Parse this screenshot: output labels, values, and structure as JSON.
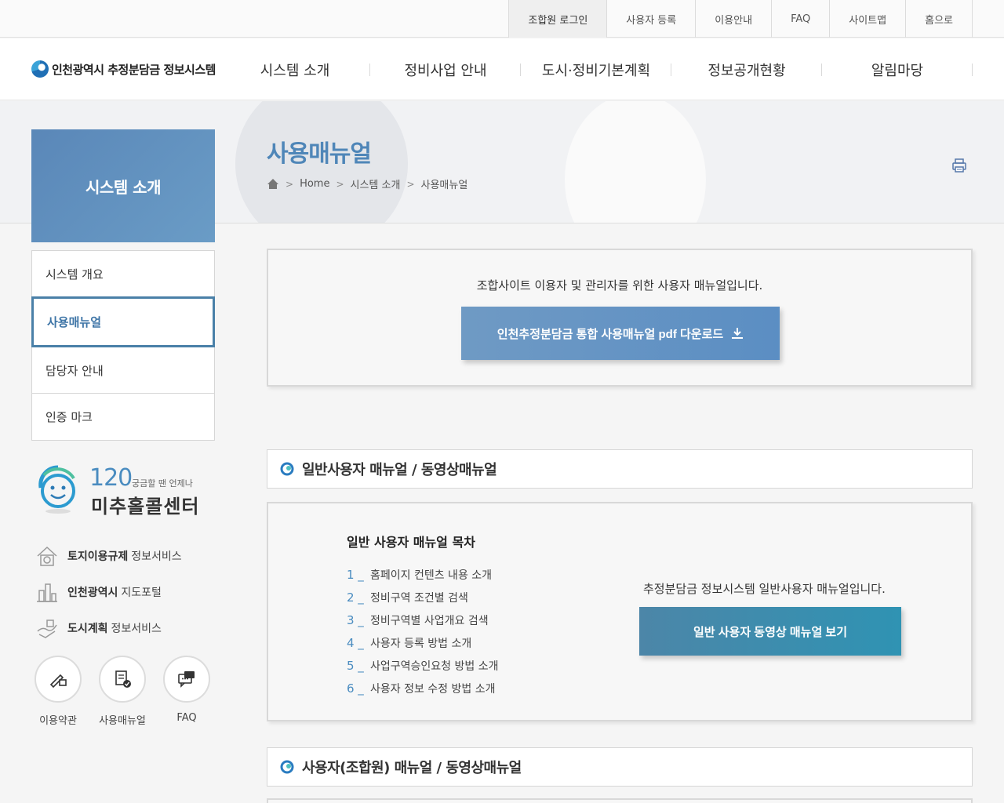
{
  "util_links": [
    "조합원 로그인",
    "사용자 등록",
    "이용안내",
    "FAQ",
    "사이트맵",
    "홈으로"
  ],
  "logo": {
    "text": "인천광역시 추정분담금 정보시스템"
  },
  "gnb": [
    "시스템 소개",
    "정비사업 안내",
    "도시·정비기본계획",
    "정보공개현황",
    "알림마당"
  ],
  "page": {
    "title": "사용매뉴얼",
    "breadcrumb": [
      "Home",
      "시스템 소개",
      "사용매뉴얼"
    ]
  },
  "sidebar": {
    "title": "시스템 소개",
    "items": [
      {
        "label": "시스템 개요"
      },
      {
        "label": "사용매뉴얼"
      },
      {
        "label": "담당자 안내"
      },
      {
        "label": "인증 마크"
      }
    ],
    "callcenter": {
      "number": "120",
      "subtitle": "궁금할 땐 언제나",
      "name": "미추홀콜센터"
    },
    "ext_links": [
      {
        "bold": "토지이용규제",
        "rest": "정보서비스",
        "icon": "land-use-icon"
      },
      {
        "bold": "인천광역시",
        "rest": "지도포털",
        "icon": "map-portal-icon"
      },
      {
        "bold": "도시계획",
        "rest": "정보서비스",
        "icon": "city-plan-icon"
      }
    ],
    "quick": [
      {
        "label": "이용약관",
        "icon": "terms-icon"
      },
      {
        "label": "사용매뉴얼",
        "icon": "manual-icon"
      },
      {
        "label": "FAQ",
        "icon": "faq-icon"
      }
    ]
  },
  "intro": {
    "text": "조합사이트 이용자 및 관리자를 위한 사용자 매뉴얼입니다.",
    "download_label": "인천추정분담금 통합 사용매뉴얼 pdf 다운로드"
  },
  "sections": [
    {
      "title": "일반사용자 매뉴얼 / 동영상매뉴얼",
      "toc_title": "일반 사용자 매뉴얼 목차",
      "toc": [
        {
          "n": "1 _",
          "text": "홈페이지 컨텐츠 내용 소개"
        },
        {
          "n": "2 _",
          "text": "정비구역 조건별 검색"
        },
        {
          "n": "3 _",
          "text": "정비구역별 사업개요 검색"
        },
        {
          "n": "4 _",
          "text": "사용자 등록 방법 소개"
        },
        {
          "n": "5 _",
          "text": "사업구역승인요청 방법 소개"
        },
        {
          "n": "6 _",
          "text": "사용자 정보 수정 방법 소개"
        }
      ],
      "desc": "추정분담금 정보시스템 일반사용자 매뉴얼입니다.",
      "video_label": "일반 사용자 동영상 매뉴얼 보기"
    },
    {
      "title": "사용자(조합원) 매뉴얼 / 동영상매뉴얼"
    }
  ],
  "colors": {
    "accent": "#4f86b8",
    "button": "#5b8ec3",
    "video_button": "#2f93b3"
  }
}
